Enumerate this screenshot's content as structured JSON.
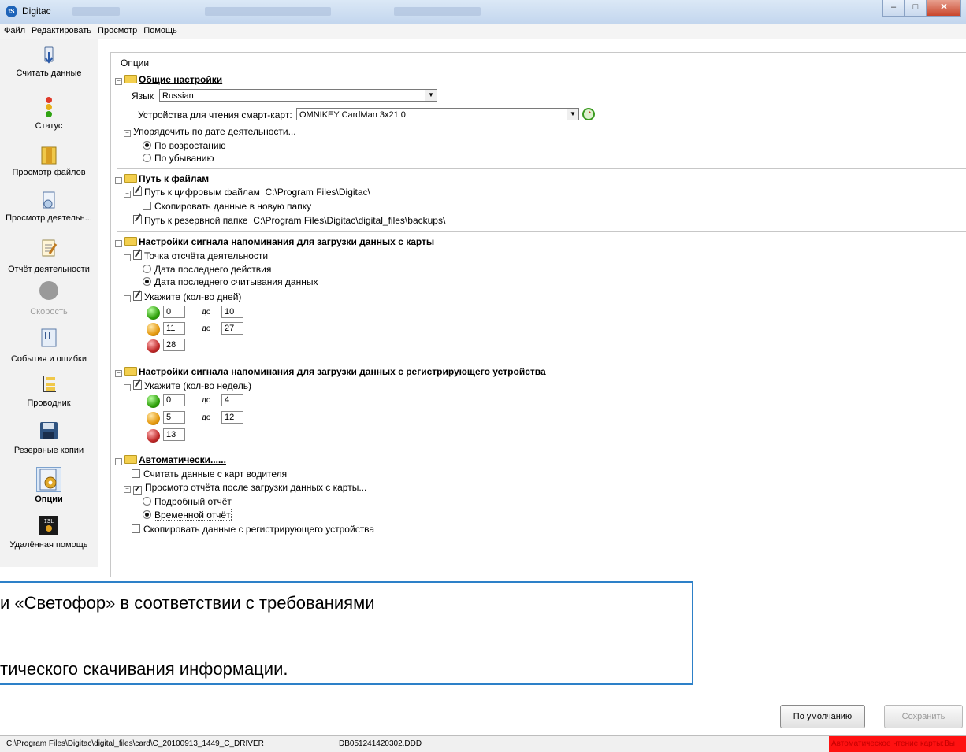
{
  "window": {
    "title": "Digitac",
    "app_icon": "fS"
  },
  "menu": [
    "Файл",
    "Редактировать",
    "Просмотр",
    "Помощь"
  ],
  "sidebar": [
    {
      "label": "Считать данные",
      "icon": "card-read-icon"
    },
    {
      "label": "Статус",
      "icon": "traffic-light-icon"
    },
    {
      "label": "Просмотр файлов",
      "icon": "files-icon"
    },
    {
      "label": "Просмотр деятельн...",
      "icon": "activity-view-icon"
    },
    {
      "label": "Отчёт деятельности",
      "icon": "report-icon"
    },
    {
      "label": "Скорость",
      "icon": "speed-icon",
      "disabled": true
    },
    {
      "label": "События и ошибки",
      "icon": "events-icon"
    },
    {
      "label": "Проводник",
      "icon": "explorer-icon"
    },
    {
      "label": "Резервные копии",
      "icon": "floppy-icon"
    },
    {
      "label": "Опции",
      "icon": "options-icon",
      "active": true
    },
    {
      "label": "Удалённая помощь",
      "icon": "isl-icon"
    }
  ],
  "options": {
    "header": "Опции",
    "general": {
      "title": "Общие настройки",
      "language_label": "Язык",
      "language_value": "Russian",
      "reader_label": "Устройства для чтения смарт-карт:",
      "reader_value": "OMNIKEY CardMan 3x21 0",
      "sort_label": "Упорядочить по дате деятельности...",
      "sort_asc": "По возростанию",
      "sort_desc": "По убыванию"
    },
    "paths": {
      "title": "Путь к файлам",
      "digital_label": "Путь к цифровым файлам",
      "digital_value": "C:\\Program Files\\Digitac\\",
      "copy_new_folder": "Скопировать данные в новую папку",
      "backup_label": "Путь к резервной папке",
      "backup_value": "C:\\Program Files\\Digitac\\digital_files\\backups\\"
    },
    "card_reminder": {
      "title": "Настройки сигнала напоминания для загрузки данных с карты",
      "ref_point": "Точка отсчёта деятельности",
      "last_action": "Дата последнего действия",
      "last_read": "Дата последнего считывания данных",
      "days_label": "Укажите (кол-во дней)",
      "to": "до",
      "green": [
        "0",
        "10"
      ],
      "yellow": [
        "11",
        "27"
      ],
      "red": "28"
    },
    "device_reminder": {
      "title": "Настройки сигнала напоминания для загрузки данных с регистрирующего устройства",
      "weeks_label": "Укажите (кол-во недель)",
      "to": "до",
      "green": [
        "0",
        "4"
      ],
      "yellow": [
        "5",
        "12"
      ],
      "red": "13"
    },
    "auto": {
      "title": "Автоматически......",
      "read_driver": "Считать данные с карт водителя",
      "view_report": "Просмотр отчёта после загрузки данных с карты...",
      "detailed": "Подробный отчёт",
      "temporary": "Временной отчёт",
      "copy_device": "Скопировать данные с регистрирующего устройства"
    }
  },
  "overlay": {
    "line1": "и «Светофор» в соответствии с требованиями",
    "line2": "тического скачивания информации."
  },
  "buttons": {
    "default": "По умолчанию",
    "save": "Сохранить"
  },
  "status": {
    "path": "C:\\Program Files\\Digitac\\digital_files\\card\\C_20100913_1449_C_DRIVER",
    "file": "DB051241420302.DDD",
    "auto_read": "Автоматическое чтение карты:Вы"
  }
}
